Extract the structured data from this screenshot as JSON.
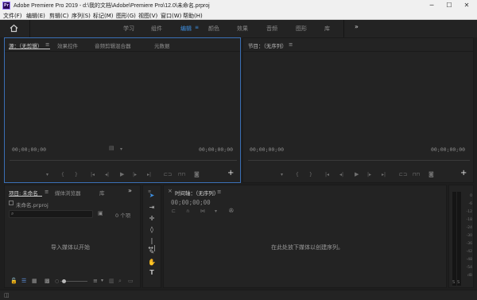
{
  "window": {
    "app_icon": "Pr",
    "title": "Adobe Premiere Pro 2019 - d:\\我的文档\\Adobe\\Premiere Pro\\12.0\\未命名.prproj",
    "minimize": "─",
    "maximize": "☐",
    "close": "✕"
  },
  "menu": [
    "文件(F)",
    "编辑(E)",
    "剪辑(C)",
    "序列(S)",
    "标记(M)",
    "图形(G)",
    "视图(V)",
    "窗口(W)",
    "帮助(H)"
  ],
  "workspaces": {
    "tabs": [
      "学习",
      "组件",
      "编辑",
      "颜色",
      "效果",
      "音频",
      "图形",
      "库"
    ],
    "active": "编辑",
    "more": "»"
  },
  "source_panel": {
    "tabs": [
      "源：（无剪辑）",
      "效果控件",
      "音频剪辑混合器",
      "元数据"
    ],
    "timecode_left": "00;00;00;00",
    "timecode_right": "00;00;00;00",
    "add_button": "+"
  },
  "program_panel": {
    "title": "节目：（无序列）",
    "timecode_left": "00;00;00;00",
    "timecode_right": "00;00;00;00",
    "add_button": "+"
  },
  "project_panel": {
    "tabs": [
      "项目: 未命名",
      "媒体浏览器",
      "库"
    ],
    "more": "»",
    "project_file": "未命名.prproj",
    "search_placeholder": "",
    "items_count": "0 个项",
    "empty_message": "导入媒体以开始"
  },
  "timeline_panel": {
    "title": "时间轴：（无序列）",
    "timecode": "00;00;00;00",
    "empty_message": "在此处放下媒体以创建序列。"
  },
  "audio_meter": {
    "labels": [
      "0",
      "-6",
      "-12",
      "-18",
      "-24",
      "-30",
      "-36",
      "-42",
      "-48",
      "-54",
      "dB"
    ],
    "solo": "S",
    "solo2": "S"
  }
}
